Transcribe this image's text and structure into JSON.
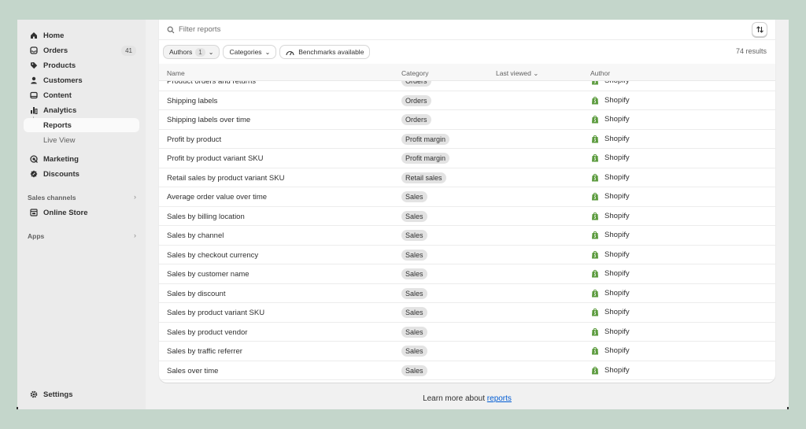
{
  "sidebar": {
    "items": [
      {
        "label": "Home",
        "icon": "home-icon"
      },
      {
        "label": "Orders",
        "icon": "orders-icon",
        "badge": "41"
      },
      {
        "label": "Products",
        "icon": "tag-icon"
      },
      {
        "label": "Customers",
        "icon": "person-icon"
      },
      {
        "label": "Content",
        "icon": "content-icon"
      },
      {
        "label": "Analytics",
        "icon": "analytics-icon"
      },
      {
        "label": "Reports",
        "icon": "",
        "active": true
      },
      {
        "label": "Live View",
        "icon": ""
      },
      {
        "label": "Marketing",
        "icon": "marketing-icon"
      },
      {
        "label": "Discounts",
        "icon": "discount-icon"
      }
    ],
    "sales_channels_label": "Sales channels",
    "online_store_label": "Online Store",
    "apps_label": "Apps",
    "settings_label": "Settings"
  },
  "search": {
    "placeholder": "Filter reports"
  },
  "filters": {
    "authors_label": "Authors",
    "authors_count": "1",
    "categories_label": "Categories",
    "benchmarks_label": "Benchmarks available"
  },
  "results_text": "74 results",
  "table": {
    "headers": {
      "name": "Name",
      "category": "Category",
      "last_viewed": "Last viewed ⌄",
      "author": "Author"
    },
    "rows": [
      {
        "name": "Product orders and returns",
        "category": "Orders",
        "author": "Shopify"
      },
      {
        "name": "Shipping labels",
        "category": "Orders",
        "author": "Shopify"
      },
      {
        "name": "Shipping labels over time",
        "category": "Orders",
        "author": "Shopify"
      },
      {
        "name": "Profit by product",
        "category": "Profit margin",
        "author": "Shopify"
      },
      {
        "name": "Profit by product variant SKU",
        "category": "Profit margin",
        "author": "Shopify"
      },
      {
        "name": "Retail sales by product variant SKU",
        "category": "Retail sales",
        "author": "Shopify"
      },
      {
        "name": "Average order value over time",
        "category": "Sales",
        "author": "Shopify"
      },
      {
        "name": "Sales by billing location",
        "category": "Sales",
        "author": "Shopify"
      },
      {
        "name": "Sales by channel",
        "category": "Sales",
        "author": "Shopify"
      },
      {
        "name": "Sales by checkout currency",
        "category": "Sales",
        "author": "Shopify"
      },
      {
        "name": "Sales by customer name",
        "category": "Sales",
        "author": "Shopify"
      },
      {
        "name": "Sales by discount",
        "category": "Sales",
        "author": "Shopify"
      },
      {
        "name": "Sales by product variant SKU",
        "category": "Sales",
        "author": "Shopify"
      },
      {
        "name": "Sales by product vendor",
        "category": "Sales",
        "author": "Shopify"
      },
      {
        "name": "Sales by traffic referrer",
        "category": "Sales",
        "author": "Shopify"
      },
      {
        "name": "Sales over time",
        "category": "Sales",
        "author": "Shopify"
      }
    ]
  },
  "footer": {
    "learn_prefix": "Learn more about",
    "learn_link": "reports"
  },
  "colors": {
    "background": "#c4d6cb",
    "link": "#005bd3",
    "shopify_green": "#5a9a3c"
  }
}
